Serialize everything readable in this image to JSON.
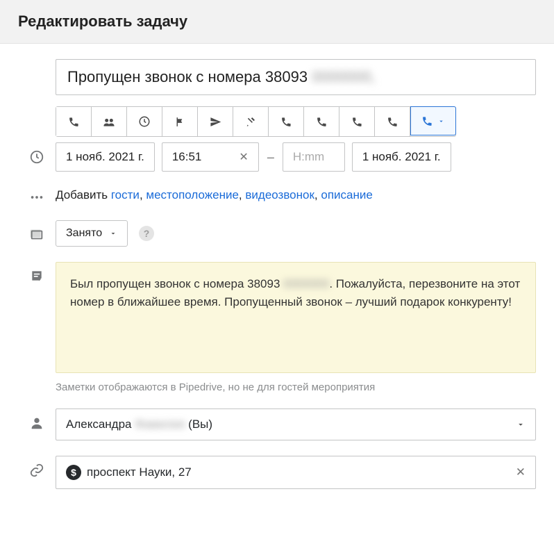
{
  "header": {
    "title": "Редактировать задачу"
  },
  "task": {
    "title_value": "Пропущен звонок с номера 38093",
    "title_blur": "0000000,"
  },
  "type_icons": [
    "phone",
    "people",
    "clock",
    "flag",
    "send",
    "utensils",
    "phone",
    "phone",
    "phone",
    "phone"
  ],
  "active_type_icon": "phone",
  "datetime": {
    "start_date": "1 нояб. 2021 г.",
    "start_time": "16:51",
    "end_time_placeholder": "H:mm",
    "end_date": "1 нояб. 2021 г."
  },
  "add_section": {
    "prefix": "Добавить ",
    "links": {
      "guests": "гости",
      "location": "местоположение",
      "video": "видеозвонок",
      "description": "описание"
    }
  },
  "busy": {
    "label": "Занято"
  },
  "note": {
    "text_before": "Был пропущен звонок с номера 38093",
    "text_blur": "0000000",
    "text_after": ". Пожалуйста, перезвоните на этот номер в ближайшее время. Пропущенный звонок – лучший подарок конкуренту!",
    "hint": "Заметки отображаются в Pipedrive, но не для гостей мероприятия"
  },
  "owner": {
    "name": "Александра",
    "name_blur": "Фамилия",
    "suffix": " (Вы)"
  },
  "deal": {
    "label": "проспект Науки, 27"
  }
}
